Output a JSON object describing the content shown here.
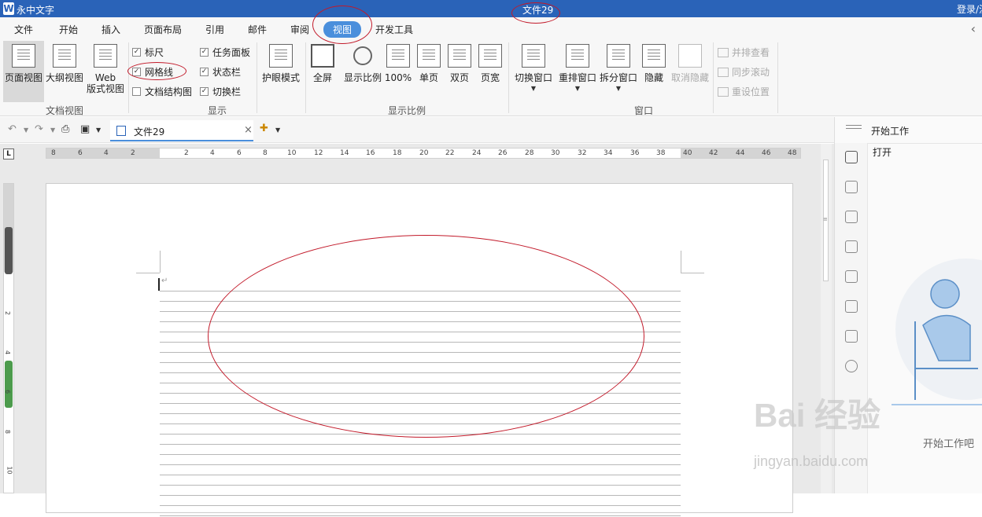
{
  "titlebar": {
    "logo": "W",
    "app_name": "永中文字",
    "doc_title": "文件29",
    "login": "登录/注"
  },
  "menu": {
    "tabs": [
      "文件",
      "开始",
      "插入",
      "页面布局",
      "引用",
      "邮件",
      "审阅",
      "视图",
      "开发工具"
    ],
    "active": "视图"
  },
  "ribbon": {
    "doc_view": {
      "page_view": "页面视图",
      "outline_view": "大纲视图",
      "web_view": "Web\n版式视图",
      "group": "文档视图"
    },
    "show": {
      "ruler": "标尺",
      "gridlines": "网格线",
      "doc_structure": "文档结构图",
      "task_pane": "任务面板",
      "status_bar": "状态栏",
      "switch_bar": "切换栏",
      "group": "显示"
    },
    "eye_mode": "护眼模式",
    "zoom": {
      "fullscreen": "全屏",
      "zoom": "显示比例",
      "hundred": "100%",
      "single": "单页",
      "double": "双页",
      "page_width": "页宽",
      "group": "显示比例"
    },
    "window": {
      "switch": "切换窗口",
      "rearrange": "重排窗口",
      "split": "拆分窗口",
      "hide": "隐藏",
      "unhide": "取消隐藏",
      "side_by_side": "并排查看",
      "sync_scroll": "同步滚动",
      "reset_position": "重设位置",
      "group": "窗口"
    }
  },
  "docbar": {
    "tab_name": "文件29",
    "close": "×"
  },
  "right_panel": {
    "title": "开始工作",
    "open": "打开",
    "empty_text": "开始工作吧"
  },
  "ruler": {
    "h_labels": [
      "8",
      "6",
      "4",
      "2",
      "2",
      "4",
      "6",
      "8",
      "10",
      "12",
      "14",
      "16",
      "18",
      "20",
      "22",
      "24",
      "26",
      "28",
      "30",
      "32",
      "34",
      "36",
      "38",
      "40",
      "42",
      "44",
      "46",
      "48"
    ],
    "v_labels": [
      "2",
      "4",
      "6",
      "8",
      "10"
    ]
  },
  "watermark": {
    "main": "Bai 经验",
    "sub": "jingyan.baidu.com"
  },
  "colors": {
    "titlebar": "#2a63b8",
    "active_tab": "#4a8fdc",
    "annotation": "#c21a2a"
  }
}
